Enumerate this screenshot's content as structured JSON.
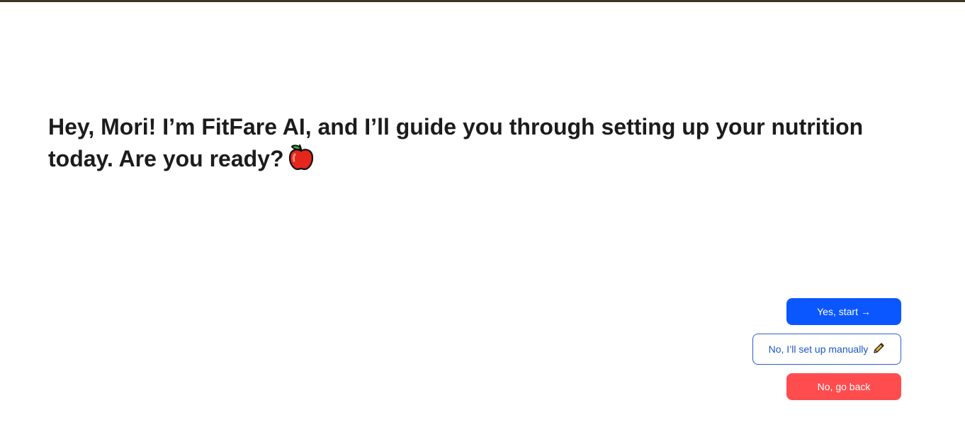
{
  "message": {
    "text": "Hey, Mori! I’m FitFare AI, and I’ll guide you through setting up your nutrition today. Are you ready?",
    "icon": "apple-icon"
  },
  "actions": {
    "yes_label": "Yes, start →",
    "manual_label": "No, I’ll set up manually",
    "manual_icon": "pencil-icon",
    "back_label": "No, go back"
  },
  "colors": {
    "top_bar": "#3b3524",
    "primary": "#0a57ff",
    "outline": "#2a5fd0",
    "danger": "#ff4d4f",
    "text": "#1c1c1c"
  }
}
